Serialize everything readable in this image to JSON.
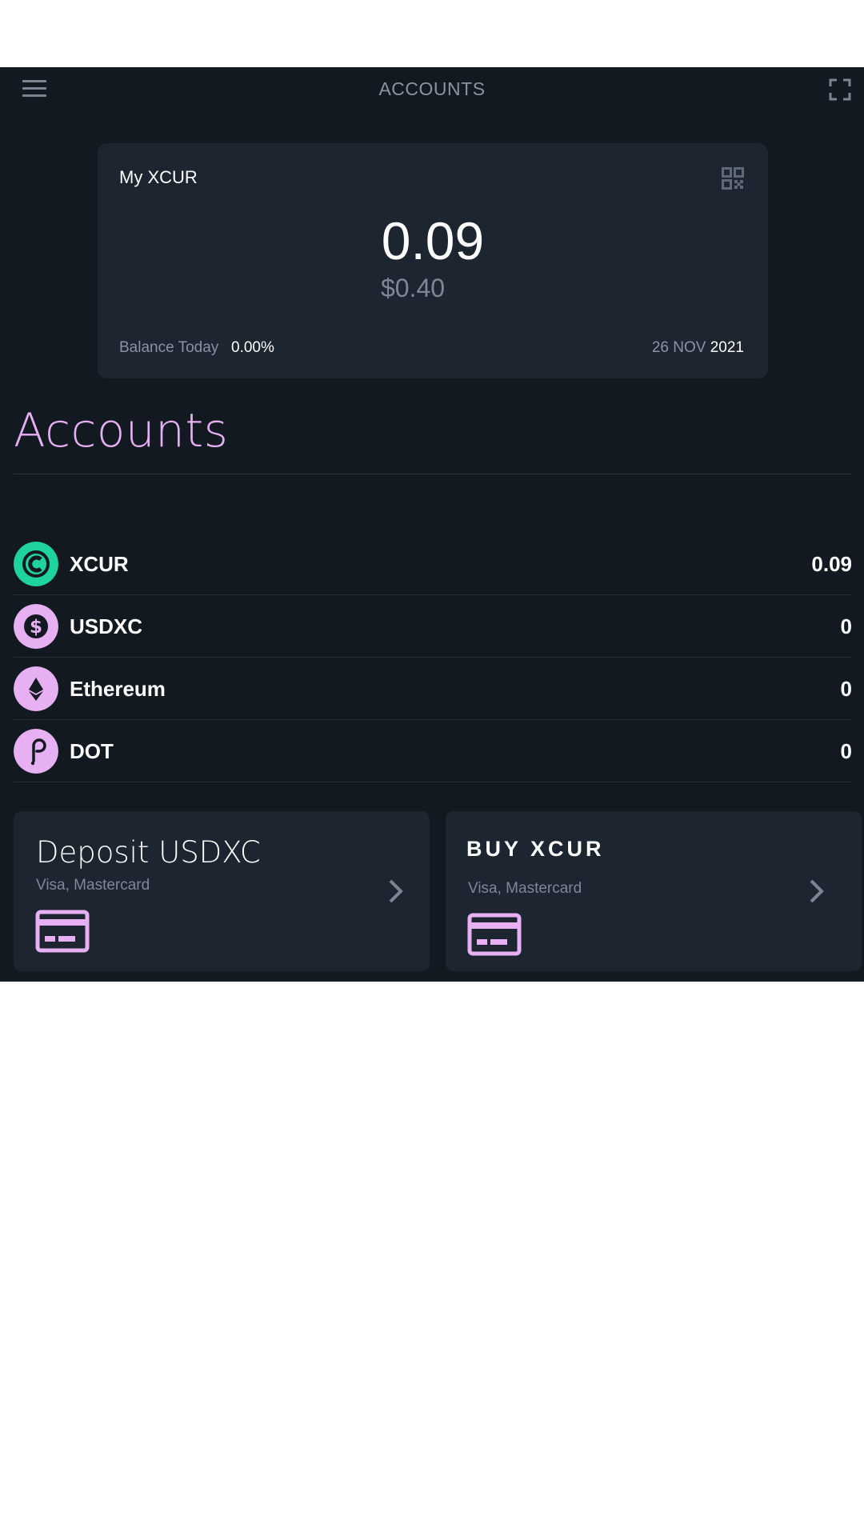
{
  "header": {
    "title": "ACCOUNTS",
    "menu_icon": "hamburger-menu-icon",
    "expand_icon": "fullscreen-icon"
  },
  "balance_card": {
    "title": "My XCUR",
    "qr_icon": "qr-code-icon",
    "amount": "0.09",
    "fiat": "$0.40",
    "balance_today_label": "Balance Today",
    "balance_today_pct": "0.00%",
    "date_day_month": "26 NOV",
    "date_year": "2021"
  },
  "accounts": {
    "title": "Accounts",
    "items": [
      {
        "name": "XCUR",
        "value": "0.09",
        "icon": "xcur-coin-icon",
        "color": "#1fd3a0"
      },
      {
        "name": "USDXC",
        "value": "0",
        "icon": "dollar-coin-icon",
        "color": "#e6b0f3"
      },
      {
        "name": "Ethereum",
        "value": "0",
        "icon": "ethereum-icon",
        "color": "#e6b0f3"
      },
      {
        "name": "DOT",
        "value": "0",
        "icon": "polkadot-icon",
        "color": "#e6b0f3"
      }
    ]
  },
  "actions": {
    "deposit": {
      "title": "Deposit USDXC",
      "subtitle": "Visa, Mastercard",
      "icon": "credit-card-icon"
    },
    "buy": {
      "title": "BUY XCUR",
      "subtitle": "Visa, Mastercard",
      "icon": "credit-card-icon"
    }
  },
  "colors": {
    "background": "#121921",
    "card": "#1d2530",
    "accent": "#e6b0f3",
    "xcur_green": "#1fd3a0",
    "muted_text": "#8a93a2"
  }
}
